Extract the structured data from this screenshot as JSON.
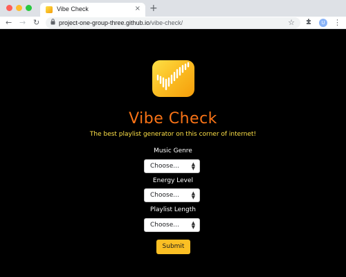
{
  "browser": {
    "tab_title": "Vibe Check",
    "tab_close": "×",
    "new_tab": "+",
    "url_host": "project-one-group-three.github.io",
    "url_path": "/vibe-check/",
    "avatar_letter": "U",
    "icons": [
      "back-icon",
      "forward-icon",
      "reload-icon",
      "lock-icon",
      "star-icon",
      "extensions-icon",
      "menu-icon"
    ]
  },
  "page": {
    "title": "Vibe Check",
    "tagline": "The best playlist generator on this corner of internet!",
    "colors": {
      "background": "#000000",
      "title": "#f97316",
      "tagline": "#fde047",
      "button": "#fbbf24"
    },
    "form": {
      "fields": [
        {
          "label": "Music Genre",
          "value": "Choose..."
        },
        {
          "label": "Energy Level",
          "value": "Choose..."
        },
        {
          "label": "Playlist Length",
          "value": "Choose..."
        }
      ],
      "submit_label": "Submit"
    }
  }
}
